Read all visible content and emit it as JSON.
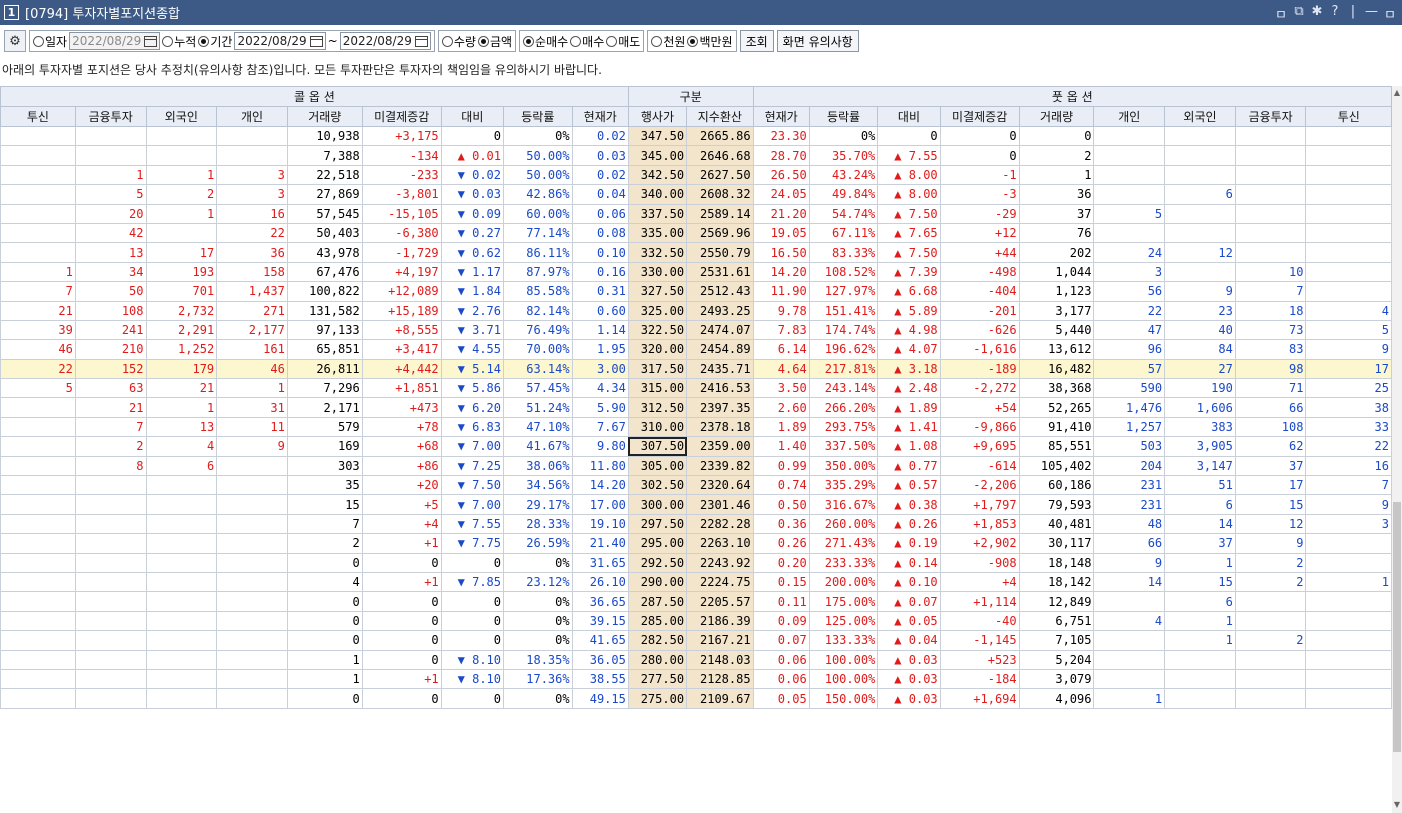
{
  "window": {
    "num": "1",
    "title": "[0794] 투자자별포지션종합",
    "controls": [
      "ㅁ",
      "⧉",
      "✱",
      "?",
      "|",
      "—",
      "ㅁ"
    ]
  },
  "toolbar": {
    "radio_daily": "일자",
    "date_daily": "2022/08/29",
    "radio_cum": "누적",
    "radio_period": "기간",
    "date_from": "2022/08/29",
    "tilde": "~",
    "date_to": "2022/08/29",
    "radio_qty": "수량",
    "radio_amt": "금액",
    "radio_netbuy": "순매수",
    "radio_buy": "매수",
    "radio_sell": "매도",
    "radio_won": "천원",
    "radio_mil": "백만원",
    "btn_query": "조회",
    "btn_notice": "화면 유의사항"
  },
  "notice": "아래의 투자자별 포지션은 당사 추정치(유의사항 참조)입니다. 모든 투자판단은 투자자의 책임임을 유의하시기 바랍니다.",
  "table": {
    "group_call": "콜 옵 션",
    "group_mid": "구분",
    "group_put": "풋 옵 션",
    "headers": [
      "투신",
      "금융투자",
      "외국인",
      "개인",
      "거래량",
      "미결제증감",
      "대비",
      "등락률",
      "현재가",
      "행사가",
      "지수환산",
      "현재가",
      "등락률",
      "대비",
      "미결제증감",
      "거래량",
      "개인",
      "외국인",
      "금융투자",
      "투신"
    ],
    "rows": [
      [
        "",
        "",
        "",
        "",
        "10,938",
        "+3,175",
        "0",
        "0%",
        "0.02",
        "347.50",
        "2665.86",
        "23.30",
        "0%",
        "0",
        "0",
        "0",
        "",
        "",
        "",
        ""
      ],
      [
        "",
        "",
        "",
        "",
        "7,388",
        "-134",
        "▲ 0.01",
        "50.00%",
        "0.03",
        "345.00",
        "2646.68",
        "28.70",
        "35.70%",
        "▲ 7.55",
        "0",
        "2",
        "",
        "",
        "",
        ""
      ],
      [
        "",
        "1",
        "1",
        "3",
        "22,518",
        "-233",
        "▼ 0.02",
        "50.00%",
        "0.02",
        "342.50",
        "2627.50",
        "26.50",
        "43.24%",
        "▲ 8.00",
        "-1",
        "1",
        "",
        "",
        "",
        ""
      ],
      [
        "",
        "5",
        "2",
        "3",
        "27,869",
        "-3,801",
        "▼ 0.03",
        "42.86%",
        "0.04",
        "340.00",
        "2608.32",
        "24.05",
        "49.84%",
        "▲ 8.00",
        "-3",
        "36",
        "",
        "6",
        "",
        ""
      ],
      [
        "",
        "20",
        "1",
        "16",
        "57,545",
        "-15,105",
        "▼ 0.09",
        "60.00%",
        "0.06",
        "337.50",
        "2589.14",
        "21.20",
        "54.74%",
        "▲ 7.50",
        "-29",
        "37",
        "5",
        "",
        "",
        ""
      ],
      [
        "",
        "42",
        "",
        "22",
        "50,403",
        "-6,380",
        "▼ 0.27",
        "77.14%",
        "0.08",
        "335.00",
        "2569.96",
        "19.05",
        "67.11%",
        "▲ 7.65",
        "+12",
        "76",
        "",
        "",
        "",
        ""
      ],
      [
        "",
        "13",
        "17",
        "36",
        "43,978",
        "-1,729",
        "▼ 0.62",
        "86.11%",
        "0.10",
        "332.50",
        "2550.79",
        "16.50",
        "83.33%",
        "▲ 7.50",
        "+44",
        "202",
        "24",
        "12",
        "",
        ""
      ],
      [
        "1",
        "34",
        "193",
        "158",
        "67,476",
        "+4,197",
        "▼ 1.17",
        "87.97%",
        "0.16",
        "330.00",
        "2531.61",
        "14.20",
        "108.52%",
        "▲ 7.39",
        "-498",
        "1,044",
        "3",
        "",
        "10",
        ""
      ],
      [
        "7",
        "50",
        "701",
        "1,437",
        "100,822",
        "+12,089",
        "▼ 1.84",
        "85.58%",
        "0.31",
        "327.50",
        "2512.43",
        "11.90",
        "127.97%",
        "▲ 6.68",
        "-404",
        "1,123",
        "56",
        "9",
        "7",
        ""
      ],
      [
        "21",
        "108",
        "2,732",
        "271",
        "131,582",
        "+15,189",
        "▼ 2.76",
        "82.14%",
        "0.60",
        "325.00",
        "2493.25",
        "9.78",
        "151.41%",
        "▲ 5.89",
        "-201",
        "3,177",
        "22",
        "23",
        "18",
        "4"
      ],
      [
        "39",
        "241",
        "2,291",
        "2,177",
        "97,133",
        "+8,555",
        "▼ 3.71",
        "76.49%",
        "1.14",
        "322.50",
        "2474.07",
        "7.83",
        "174.74%",
        "▲ 4.98",
        "-626",
        "5,440",
        "47",
        "40",
        "73",
        "5"
      ],
      [
        "46",
        "210",
        "1,252",
        "161",
        "65,851",
        "+3,417",
        "▼ 4.55",
        "70.00%",
        "1.95",
        "320.00",
        "2454.89",
        "6.14",
        "196.62%",
        "▲ 4.07",
        "-1,616",
        "13,612",
        "96",
        "84",
        "83",
        "9"
      ],
      [
        "22",
        "152",
        "179",
        "46",
        "26,811",
        "+4,442",
        "▼ 5.14",
        "63.14%",
        "3.00",
        "317.50",
        "2435.71",
        "4.64",
        "217.81%",
        "▲ 3.18",
        "-189",
        "16,482",
        "57",
        "27",
        "98",
        "17"
      ],
      [
        "5",
        "63",
        "21",
        "1",
        "7,296",
        "+1,851",
        "▼ 5.86",
        "57.45%",
        "4.34",
        "315.00",
        "2416.53",
        "3.50",
        "243.14%",
        "▲ 2.48",
        "-2,272",
        "38,368",
        "590",
        "190",
        "71",
        "25"
      ],
      [
        "",
        "21",
        "1",
        "31",
        "2,171",
        "+473",
        "▼ 6.20",
        "51.24%",
        "5.90",
        "312.50",
        "2397.35",
        "2.60",
        "266.20%",
        "▲ 1.89",
        "+54",
        "52,265",
        "1,476",
        "1,606",
        "66",
        "38"
      ],
      [
        "",
        "7",
        "13",
        "11",
        "579",
        "+78",
        "▼ 6.83",
        "47.10%",
        "7.67",
        "310.00",
        "2378.18",
        "1.89",
        "293.75%",
        "▲ 1.41",
        "-9,866",
        "91,410",
        "1,257",
        "383",
        "108",
        "33"
      ],
      [
        "",
        "2",
        "4",
        "9",
        "169",
        "+68",
        "▼ 7.00",
        "41.67%",
        "9.80",
        "307.50",
        "2359.00",
        "1.40",
        "337.50%",
        "▲ 1.08",
        "+9,695",
        "85,551",
        "503",
        "3,905",
        "62",
        "22"
      ],
      [
        "",
        "8",
        "6",
        "",
        "303",
        "+86",
        "▼ 7.25",
        "38.06%",
        "11.80",
        "305.00",
        "2339.82",
        "0.99",
        "350.00%",
        "▲ 0.77",
        "-614",
        "105,402",
        "204",
        "3,147",
        "37",
        "16"
      ],
      [
        "",
        "",
        "",
        "",
        "35",
        "+20",
        "▼ 7.50",
        "34.56%",
        "14.20",
        "302.50",
        "2320.64",
        "0.74",
        "335.29%",
        "▲ 0.57",
        "-2,206",
        "60,186",
        "231",
        "51",
        "17",
        "7"
      ],
      [
        "",
        "",
        "",
        "",
        "15",
        "+5",
        "▼ 7.00",
        "29.17%",
        "17.00",
        "300.00",
        "2301.46",
        "0.50",
        "316.67%",
        "▲ 0.38",
        "+1,797",
        "79,593",
        "231",
        "6",
        "15",
        "9"
      ],
      [
        "",
        "",
        "",
        "",
        "7",
        "+4",
        "▼ 7.55",
        "28.33%",
        "19.10",
        "297.50",
        "2282.28",
        "0.36",
        "260.00%",
        "▲ 0.26",
        "+1,853",
        "40,481",
        "48",
        "14",
        "12",
        "3"
      ],
      [
        "",
        "",
        "",
        "",
        "2",
        "+1",
        "▼ 7.75",
        "26.59%",
        "21.40",
        "295.00",
        "2263.10",
        "0.26",
        "271.43%",
        "▲ 0.19",
        "+2,902",
        "30,117",
        "66",
        "37",
        "9",
        ""
      ],
      [
        "",
        "",
        "",
        "",
        "0",
        "0",
        "0",
        "0%",
        "31.65",
        "292.50",
        "2243.92",
        "0.20",
        "233.33%",
        "▲ 0.14",
        "-908",
        "18,148",
        "9",
        "1",
        "2",
        ""
      ],
      [
        "",
        "",
        "",
        "",
        "4",
        "+1",
        "▼ 7.85",
        "23.12%",
        "26.10",
        "290.00",
        "2224.75",
        "0.15",
        "200.00%",
        "▲ 0.10",
        "+4",
        "18,142",
        "14",
        "15",
        "2",
        "1"
      ],
      [
        "",
        "",
        "",
        "",
        "0",
        "0",
        "0",
        "0%",
        "36.65",
        "287.50",
        "2205.57",
        "0.11",
        "175.00%",
        "▲ 0.07",
        "+1,114",
        "12,849",
        "",
        "6",
        "",
        ""
      ],
      [
        "",
        "",
        "",
        "",
        "0",
        "0",
        "0",
        "0%",
        "39.15",
        "285.00",
        "2186.39",
        "0.09",
        "125.00%",
        "▲ 0.05",
        "-40",
        "6,751",
        "4",
        "1",
        "",
        ""
      ],
      [
        "",
        "",
        "",
        "",
        "0",
        "0",
        "0",
        "0%",
        "41.65",
        "282.50",
        "2167.21",
        "0.07",
        "133.33%",
        "▲ 0.04",
        "-1,145",
        "7,105",
        "",
        "1",
        "2",
        ""
      ],
      [
        "",
        "",
        "",
        "",
        "1",
        "0",
        "▼ 8.10",
        "18.35%",
        "36.05",
        "280.00",
        "2148.03",
        "0.06",
        "100.00%",
        "▲ 0.03",
        "+523",
        "5,204",
        "",
        "",
        "",
        ""
      ],
      [
        "",
        "",
        "",
        "",
        "1",
        "+1",
        "▼ 8.10",
        "17.36%",
        "38.55",
        "277.50",
        "2128.85",
        "0.06",
        "100.00%",
        "▲ 0.03",
        "-184",
        "3,079",
        "",
        "",
        "",
        ""
      ],
      [
        "",
        "",
        "",
        "",
        "0",
        "0",
        "0",
        "0%",
        "49.15",
        "275.00",
        "2109.67",
        "0.05",
        "150.00%",
        "▲ 0.03",
        "+1,694",
        "4,096",
        "1",
        "",
        "",
        ""
      ]
    ]
  }
}
